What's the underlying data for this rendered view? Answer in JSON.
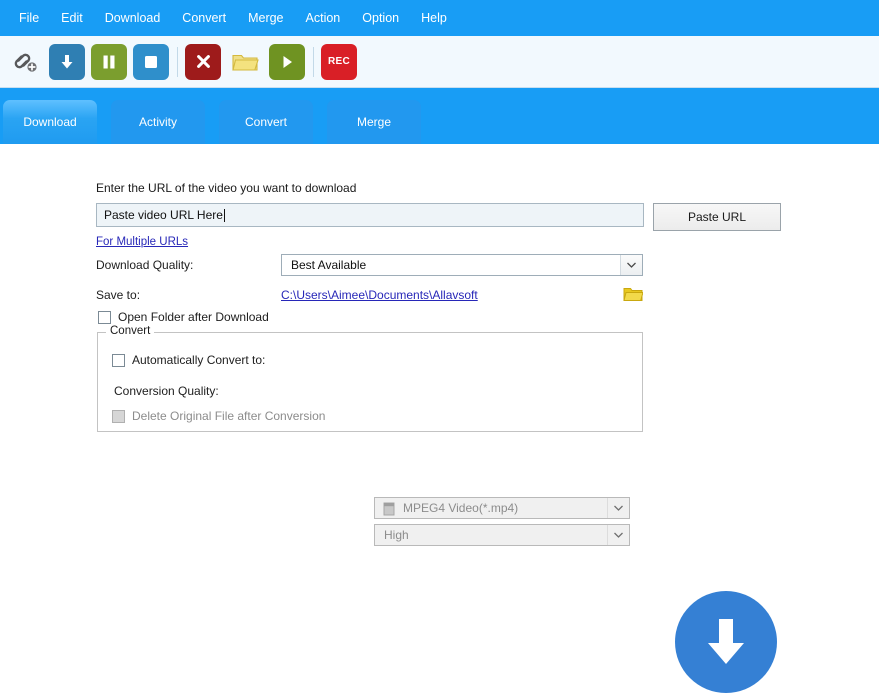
{
  "menubar": {
    "items": [
      {
        "label": "File"
      },
      {
        "label": "Edit"
      },
      {
        "label": "Download"
      },
      {
        "label": "Convert"
      },
      {
        "label": "Merge"
      },
      {
        "label": "Action"
      },
      {
        "label": "Option"
      },
      {
        "label": "Help"
      }
    ]
  },
  "toolbar": {
    "buttons": [
      {
        "name": "add-link-icon",
        "label": ""
      },
      {
        "name": "download-icon",
        "label": ""
      },
      {
        "name": "pause-icon",
        "label": ""
      },
      {
        "name": "stop-icon",
        "label": ""
      },
      {
        "name": "delete-icon",
        "label": ""
      },
      {
        "name": "open-folder-icon",
        "label": ""
      },
      {
        "name": "play-icon",
        "label": ""
      },
      {
        "name": "record-icon",
        "label": "REC"
      }
    ],
    "rec_label": "REC"
  },
  "tabs": [
    {
      "label": "Download",
      "active": true
    },
    {
      "label": "Activity",
      "active": false
    },
    {
      "label": "Convert",
      "active": false
    },
    {
      "label": "Merge",
      "active": false
    }
  ],
  "download_panel": {
    "url_label": "Enter the URL of the video you want to download",
    "url_value": "Paste video URL Here",
    "url_placeholder": "Paste video URL Here",
    "paste_button": "Paste URL",
    "multiple_urls_link": "For Multiple URLs",
    "download_quality_label": "Download Quality:",
    "download_quality_value": "Best Available",
    "save_to_label": "Save to:",
    "save_to_path": "C:\\Users\\Aimee\\Documents\\Allavsoft",
    "open_folder_checkbox": "Open Folder after Download",
    "convert_group_title": "Convert",
    "auto_convert_checkbox": "Automatically Convert to:",
    "format_value": "MPEG4 Video(*.mp4)",
    "conversion_quality_label": "Conversion Quality:",
    "conversion_quality_value": "High",
    "delete_original_checkbox": "Delete Original File after Conversion"
  },
  "colors": {
    "accent_blue": "#189df5",
    "tab_blue": "#2298ef",
    "link_blue": "#2727b8",
    "big_button_blue": "#3580d4",
    "toolbar_bg": "#f2f9fe",
    "rec_red": "#d91f26",
    "folder_yellow": "#e8c81e"
  }
}
